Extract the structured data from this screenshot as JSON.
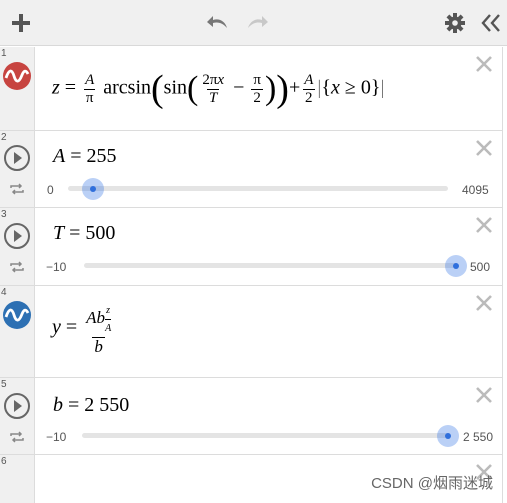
{
  "toolbar": {
    "add_icon": "plus-icon",
    "undo_icon": "undo-icon",
    "redo_icon": "redo-icon",
    "settings_icon": "gear-icon",
    "collapse_icon": "double-chevron-left-icon"
  },
  "expressions": [
    {
      "index": "1",
      "type": "function",
      "color": "#c74440",
      "latex_text": "z = A/π arcsin(sin(2πx/T − π/2)) + A/2 {x ≥ 0}"
    },
    {
      "index": "2",
      "type": "slider",
      "variable": "A",
      "value": "255",
      "min": "0",
      "max": "4095",
      "fraction": 0.062
    },
    {
      "index": "3",
      "type": "slider",
      "variable": "T",
      "value": "500",
      "min": "−10",
      "max": "500",
      "fraction": 1.0
    },
    {
      "index": "4",
      "type": "function",
      "color": "#2d70b3",
      "latex_text": "y = A b^(z/A) / b"
    },
    {
      "index": "5",
      "type": "slider",
      "variable": "b",
      "value": "2 550",
      "min": "−10",
      "max": "2 550",
      "fraction": 1.0
    },
    {
      "index": "6",
      "type": "empty"
    }
  ],
  "watermark": "CSDN @烟雨迷城"
}
